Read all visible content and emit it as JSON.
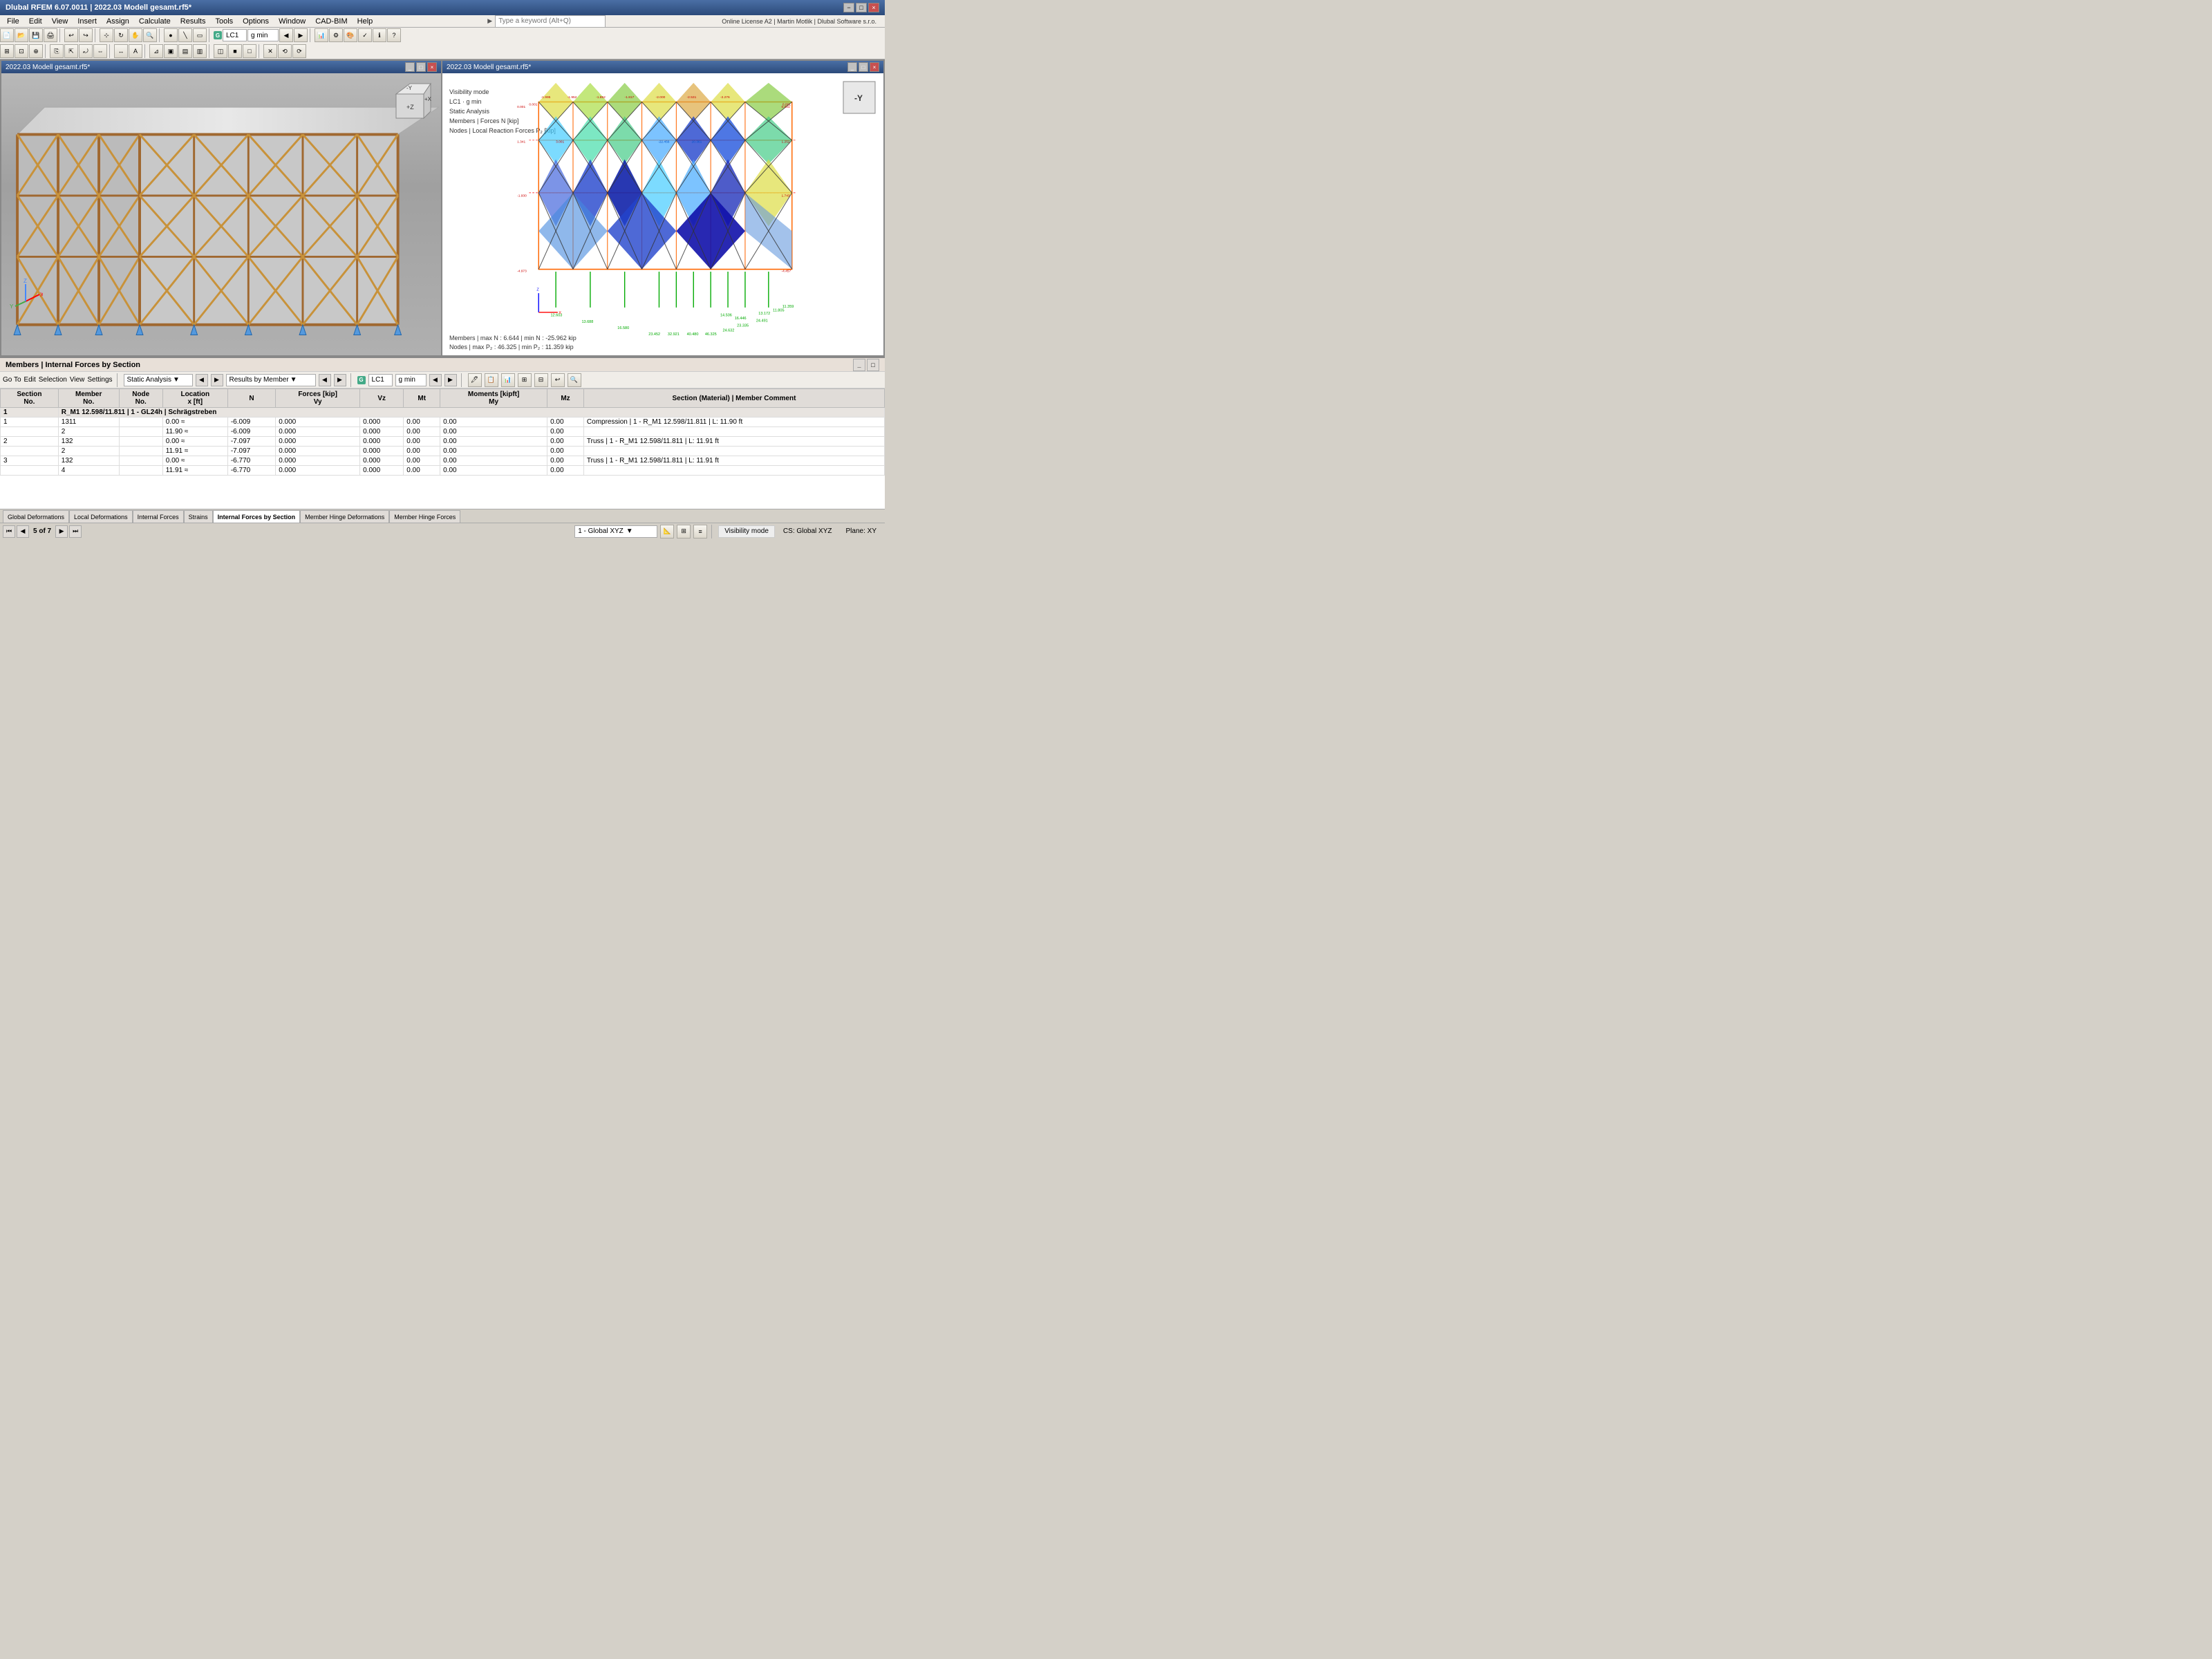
{
  "app": {
    "title": "Dlubal RFEM 6.07.0011 | 2022.03 Modell gesamt.rf5*",
    "close_label": "×",
    "minimize_label": "−",
    "maximize_label": "□"
  },
  "menu": {
    "items": [
      "File",
      "Edit",
      "View",
      "Insert",
      "Assign",
      "Calculate",
      "Results",
      "Tools",
      "Options",
      "Window",
      "CAD-BIM",
      "Help"
    ]
  },
  "search": {
    "placeholder": "Type a keyword (Alt+Q)"
  },
  "license": {
    "text": "Online License A2 | Martin Motlik | Dlubal Software s.r.o."
  },
  "lc_selector": {
    "label": "G",
    "value": "LC1",
    "name": "g min"
  },
  "viewports": {
    "left": {
      "title": "2022.03 Modell gesamt.rf5*"
    },
    "right": {
      "title": "2022.03 Modell gesamt.rf5*",
      "info_lines": [
        "Visibility mode",
        "LC1 · g min",
        "Static Analysis",
        "Members | Forces N [kip]",
        "Nodes | Local Reaction Forces P₂ [kip]"
      ],
      "stats": [
        "Members | max N : 6.644 | min N : -25.962 kip",
        "Nodes | max P₂ : 46.325 | min P₂ : 11.359 kip"
      ],
      "axis_label_x": "X",
      "axis_label_z": "Z"
    }
  },
  "bottom_panel": {
    "title": "Members | Internal Forces by Section",
    "controls": {
      "go_to": "Go To",
      "edit": "Edit",
      "selection": "Selection",
      "view": "View",
      "settings": "Settings"
    },
    "analysis": "Static Analysis",
    "results_by": "Results by Member",
    "lc_label": "G",
    "lc_value": "LC1",
    "lc_name": "g min"
  },
  "table": {
    "headers": [
      "Section No.",
      "Member No.",
      "Node No.",
      "Location x [ft]",
      "N",
      "Forces [kip] Vy",
      "Vz",
      "Mt",
      "Moments [kipft] My",
      "Mz",
      "Section (Material) | Member Comment"
    ],
    "rows": [
      {
        "section": "1",
        "member": "R_M1 12.598/11.811 | 1 - GL24h | Schrägstreben",
        "sub_rows": [
          {
            "sub": "1",
            "node": "1311",
            "loc": "0.00 ≈",
            "N": "-6.009",
            "Vy": "0.000",
            "Vz": "0.000",
            "Mt": "0.00",
            "My": "0.00",
            "Mz": "0.00",
            "comment": "Compression | 1 - R_M1 12.598/11.811 | L: 11.90 ft"
          },
          {
            "sub": "",
            "node": "2",
            "loc": "11.90 ≈",
            "N": "-6.009",
            "Vy": "0.000",
            "Vz": "0.000",
            "Mt": "0.00",
            "My": "0.00",
            "Mz": "0.00",
            "comment": ""
          },
          {
            "sub": "2",
            "node": "132",
            "loc": "0.00 ≈",
            "N": "-7.097",
            "Vy": "0.000",
            "Vz": "0.000",
            "Mt": "0.00",
            "My": "0.00",
            "Mz": "0.00",
            "comment": "Truss | 1 - R_M1 12.598/11.811 | L: 11.91 ft"
          },
          {
            "sub": "",
            "node": "2",
            "loc": "11.91 ≈",
            "N": "-7.097",
            "Vy": "0.000",
            "Vz": "0.000",
            "Mt": "0.00",
            "My": "0.00",
            "Mz": "0.00",
            "comment": ""
          },
          {
            "sub": "3",
            "node": "132",
            "loc": "0.00 ≈",
            "N": "-6.770",
            "Vy": "0.000",
            "Vz": "0.000",
            "Mt": "0.00",
            "My": "0.00",
            "Mz": "0.00",
            "comment": "Truss | 1 - R_M1 12.598/11.811 | L: 11.91 ft"
          },
          {
            "sub": "",
            "node": "4",
            "loc": "11.91 ≈",
            "N": "-6.770",
            "Vy": "0.000",
            "Vz": "0.000",
            "Mt": "0.00",
            "My": "0.00",
            "Mz": "0.00",
            "comment": ""
          }
        ]
      }
    ]
  },
  "tabs": [
    "Global Deformations",
    "Local Deformations",
    "Internal Forces",
    "Strains",
    "Internal Forces by Section",
    "Member Hinge Deformations",
    "Member Hinge Forces"
  ],
  "active_tab": "Internal Forces by Section",
  "navigation": {
    "page_info": "5 of 7",
    "first": "⏮",
    "prev": "◀",
    "next": "▶",
    "last": "⏭"
  },
  "status_bar": {
    "cs": "1 - Global XYZ",
    "visibility": "Visibility mode",
    "cs_global": "CS: Global XYZ",
    "plane": "Plane: XY"
  },
  "force_values": {
    "top_row": [
      "-1.995",
      "-1.952",
      "-1.852",
      "-1.817",
      "-2.000",
      "-2.531",
      "-2.276"
    ],
    "reaction_values": [
      "12.603",
      "13.688",
      "16.580",
      "23.452",
      "32.921",
      "40.480",
      "46.325",
      "24.632",
      "23.335",
      "24.491",
      "14.506",
      "16.446",
      "13.172",
      "11.805",
      "11.359"
    ],
    "max_N": "6.644",
    "min_N": "-25.962",
    "max_Pz": "46.325",
    "min_Pz": "11.359"
  }
}
